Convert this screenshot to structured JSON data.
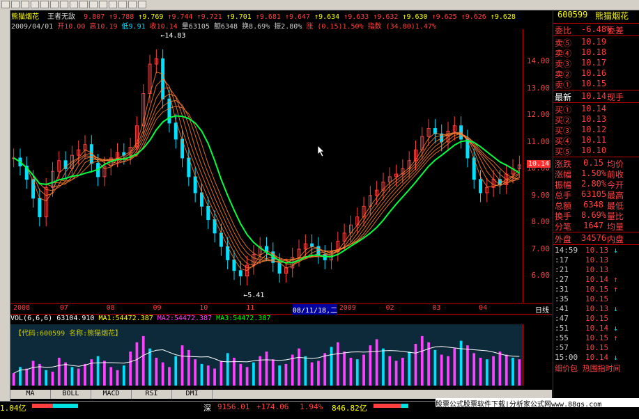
{
  "toolbar": {
    "title": "能猫烟花"
  },
  "tick_strip": {
    "name": "熊猫烟花",
    "subtitle": "王者无敌",
    "prices": [
      "9.807",
      "9.788",
      "9.769",
      "9.744",
      "9.721",
      "9.701",
      "9.681",
      "9.647",
      "9.634",
      "9.633",
      "9.632",
      "9.630",
      "9.625",
      "9.626",
      "9.628"
    ]
  },
  "info": {
    "date": "2009/04/01",
    "open": "开10.00",
    "high": "高10.19",
    "low": "低9.91",
    "close": "收10.14",
    "volume": "量63105",
    "amount": "额6348",
    "turnover": "换8.69%",
    "amplitude": "振2.80%",
    "change": "涨 (0.15)1.50%",
    "index": "指数 (34.80)1.47%"
  },
  "chart_data": {
    "type": "line",
    "title": "",
    "period": "日线",
    "ylim": [
      5.0,
      15.2
    ],
    "yticks": [
      "14.00",
      "13.00",
      "12.00",
      "11.00",
      "10.00",
      "9.00",
      "8.00",
      "7.00",
      "6.00"
    ],
    "date_ticks": [
      "2008",
      "07",
      "08",
      "09",
      "10",
      "11",
      "08/11/18,二",
      "2009",
      "02",
      "03",
      "04"
    ],
    "annotations": {
      "high": "14.83",
      "low": "5.41"
    },
    "current_price": "10.14",
    "close_series": [
      10.4,
      10.1,
      9.6,
      8.9,
      8.2,
      9.3,
      9.9,
      10.3,
      10.0,
      10.5,
      10.7,
      10.9,
      10.2,
      9.7,
      10.1,
      10.4,
      10.6,
      10.5,
      10.8,
      11.6,
      12.8,
      13.9,
      14.1,
      12.6,
      11.7,
      11.1,
      10.4,
      9.7,
      9.1,
      8.6,
      8.1,
      7.6,
      7.1,
      6.6,
      6.2,
      6.0,
      6.4,
      6.8,
      7.1,
      6.9,
      6.5,
      6.1,
      6.3,
      6.7,
      7.0,
      7.2,
      7.1,
      6.8,
      6.6,
      6.9,
      7.3,
      7.6,
      7.9,
      8.2,
      8.6,
      9.0,
      9.2,
      9.5,
      9.7,
      9.8,
      10.0,
      10.3,
      10.7,
      11.2,
      11.5,
      11.3,
      11.0,
      11.4,
      11.6,
      11.1,
      10.4,
      9.6,
      9.1,
      9.3,
      9.6,
      9.4,
      9.8,
      10.0,
      10.14
    ]
  },
  "volume": {
    "label": "VOL(6,6,6)",
    "vol": "63104.910",
    "ma1": "MA1:54472.387",
    "ma2": "MA2:54472.387",
    "ma3": "MA3:54472.387",
    "code_label": "【代码:600599 名称:熊猫烟花】",
    "yticks": [
      "150000",
      "100000",
      "50000"
    ],
    "values": [
      40,
      60,
      55,
      80,
      70,
      50,
      45,
      90,
      75,
      60,
      55,
      70,
      85,
      95,
      80,
      60,
      50,
      65,
      110,
      140,
      160,
      120,
      90,
      75,
      60,
      95,
      130,
      115,
      85,
      70,
      65,
      55,
      80,
      105,
      90,
      70,
      60,
      75,
      95,
      110,
      85,
      65,
      70,
      100,
      120,
      95,
      75,
      80,
      105,
      125,
      140,
      110,
      90,
      85,
      100,
      130,
      150,
      120,
      95,
      80,
      90,
      110,
      135,
      160,
      140,
      115,
      100,
      95,
      120,
      145,
      130,
      105,
      90,
      85,
      95,
      110,
      100,
      90,
      85
    ]
  },
  "tabs": [
    "MA",
    "BOLL",
    "MACD",
    "RSI",
    "DMI"
  ],
  "right_panel": {
    "code": "600599",
    "name": "熊猫烟花",
    "webi": {
      "label": "委比",
      "value": "-6.48%",
      "label2": "委差"
    },
    "sell": [
      {
        "label": "卖⑤",
        "value": "10.19"
      },
      {
        "label": "卖④",
        "value": "10.18"
      },
      {
        "label": "卖③",
        "value": "10.17"
      },
      {
        "label": "卖②",
        "value": "10.16"
      },
      {
        "label": "卖①",
        "value": "10.15"
      }
    ],
    "latest": {
      "label": "最新",
      "value": "10.14",
      "label2": "现手"
    },
    "buy": [
      {
        "label": "买①",
        "value": "10.14"
      },
      {
        "label": "买②",
        "value": "10.13"
      },
      {
        "label": "买③",
        "value": "10.12"
      },
      {
        "label": "买④",
        "value": "10.11"
      },
      {
        "label": "买⑤",
        "value": "10.10"
      }
    ],
    "stats": [
      {
        "label": "涨跌",
        "value": "0.15",
        "label2": "均价"
      },
      {
        "label": "涨幅",
        "value": "1.50%",
        "label2": "前收"
      },
      {
        "label": "振幅",
        "value": "2.80%",
        "label2": "今开"
      },
      {
        "label": "总手",
        "value": "63105",
        "label2": "最高"
      },
      {
        "label": "总额",
        "value": "6348",
        "label2": "最低"
      },
      {
        "label": "换手",
        "value": "8.69%",
        "label2": "量比"
      },
      {
        "label": "分笔",
        "value": "1647",
        "label2": "均量"
      }
    ],
    "outer": {
      "label": "外盘",
      "value": "34576",
      "label2": "内盘"
    },
    "trades": [
      {
        "time": "14:59",
        "price": "10.13",
        "dir": "down"
      },
      {
        "time": ":17",
        "price": "10.13",
        "dir": ""
      },
      {
        "time": ":21",
        "price": "10.13",
        "dir": ""
      },
      {
        "time": ":27",
        "price": "10.14",
        "dir": "up"
      },
      {
        "time": ":31",
        "price": "10.15",
        "dir": "up"
      },
      {
        "time": ":35",
        "price": "10.15",
        "dir": ""
      },
      {
        "time": ":41",
        "price": "10.13",
        "dir": "down"
      },
      {
        "time": ":47",
        "price": "10.15",
        "dir": ""
      },
      {
        "time": ":51",
        "price": "10.14",
        "dir": "down"
      },
      {
        "time": ":55",
        "price": "10.15",
        "dir": "up"
      },
      {
        "time": ":57",
        "price": "10.15",
        "dir": ""
      },
      {
        "time": "15:00",
        "price": "10.14",
        "dir": "down"
      }
    ],
    "footer": "细价包 热围指时间"
  },
  "statusbar": {
    "left_value": "1.04亿",
    "sz_label": "深",
    "sz_index": "9156.01",
    "sz_change": "+174.06",
    "sz_pct": "1.94%",
    "sz_amount": "846.82亿"
  },
  "watermark": "股票公式股票软件下载|分析家公式网www.88gs.com",
  "colors": {
    "up": "#ff4040",
    "down": "#00e0ff",
    "ma_green": "#00ff40",
    "ma_orange": "#ff8030",
    "panel_border": "#c00000"
  }
}
